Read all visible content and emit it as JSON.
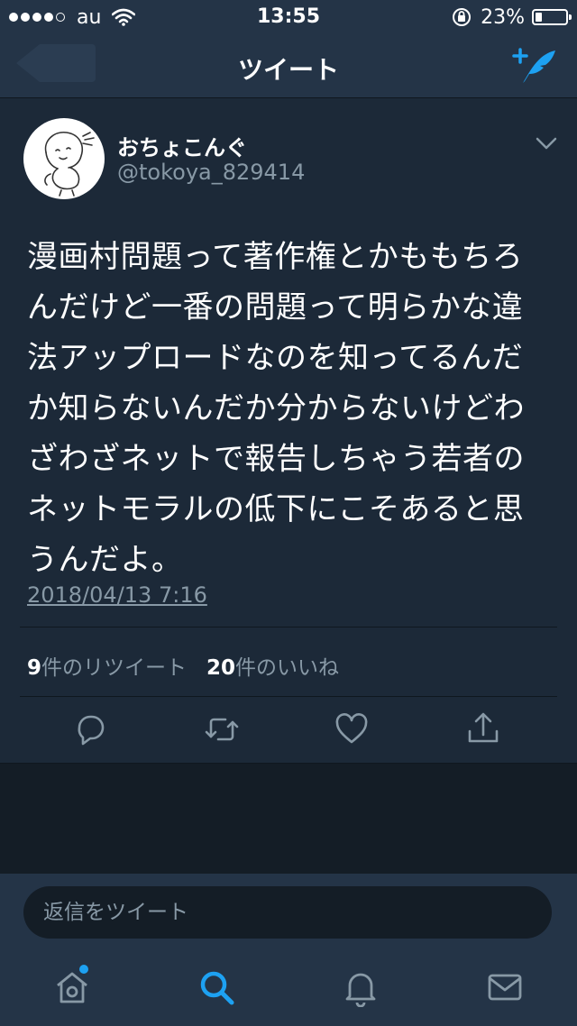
{
  "status_bar": {
    "carrier": "au",
    "time": "13:55",
    "battery": "23%",
    "battery_level": 0.23
  },
  "nav": {
    "title": "ツイート"
  },
  "tweet": {
    "author_name": "おちょこんぐ",
    "author_handle": "@tokoya_829414",
    "text": "漫画村問題って著作権とかももちろんだけど一番の問題って明らかな違法アップロードなのを知ってるんだか知らないんだか分からないけどわざわざネットで報告しちゃう若者のネットモラルの低下にこそあると思うんだよ。",
    "date": "2018/04/13 7:16",
    "retweet_count": "9",
    "retweet_label": "件のリツイート",
    "like_count": "20",
    "like_label": "件のいいね"
  },
  "reply": {
    "placeholder": "返信をツイート"
  },
  "icons": {
    "back": "back-arrow-icon",
    "compose": "compose-tweet-icon",
    "chevron": "chevron-down-icon",
    "reply": "reply-icon",
    "retweet": "retweet-icon",
    "like": "heart-icon",
    "share": "share-icon",
    "home": "home-icon",
    "search": "search-icon",
    "notifications": "bell-icon",
    "messages": "mail-icon"
  },
  "colors": {
    "background": "#1c2938",
    "bar": "#243447",
    "accent": "#1da1f2",
    "secondary_text": "#8899a6"
  }
}
